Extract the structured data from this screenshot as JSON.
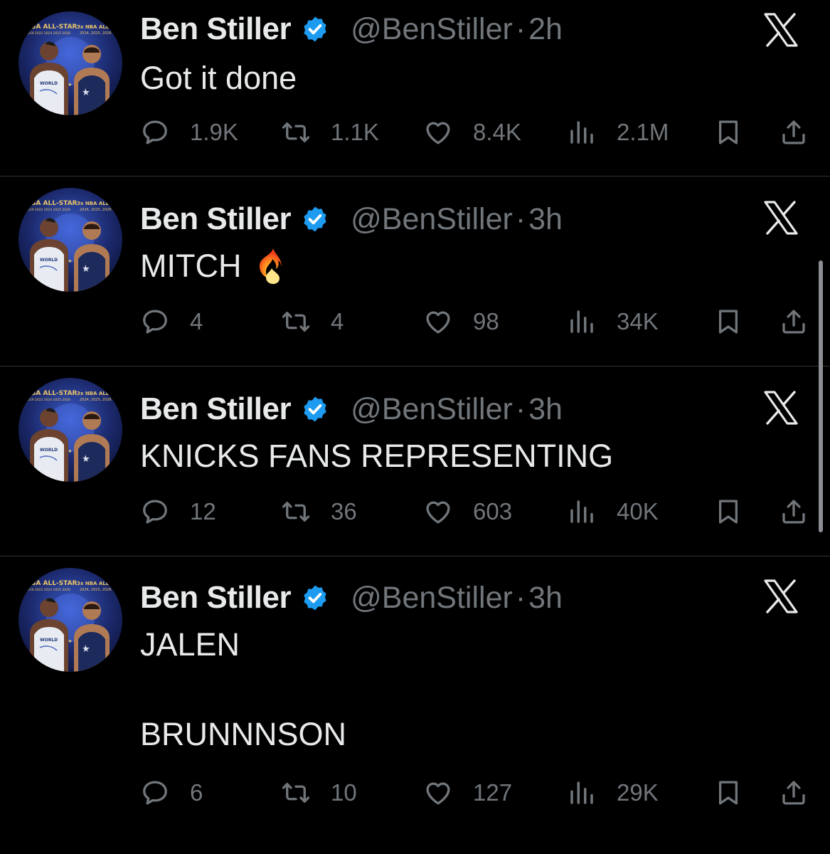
{
  "tweets": [
    {
      "name": "Ben Stiller",
      "handle": "@BenStiller",
      "separator": "·",
      "time": "2h",
      "text": "Got it done",
      "emoji": "",
      "replies": "1.9K",
      "retweets": "1.1K",
      "likes": "8.4K",
      "views": "2.1M"
    },
    {
      "name": "Ben Stiller",
      "handle": "@BenStiller",
      "separator": "·",
      "time": "3h",
      "text": "MITCH",
      "emoji": "fire-icon",
      "replies": "4",
      "retweets": "4",
      "likes": "98",
      "views": "34K"
    },
    {
      "name": "Ben Stiller",
      "handle": "@BenStiller",
      "separator": "·",
      "time": "3h",
      "text": "KNICKS FANS REPRESENTING",
      "emoji": "",
      "replies": "12",
      "retweets": "36",
      "likes": "603",
      "views": "40K"
    },
    {
      "name": "Ben Stiller",
      "handle": "@BenStiller",
      "separator": "·",
      "time": "3h",
      "text": "JALEN\n\nBRUNNNSON",
      "emoji": "",
      "replies": "6",
      "retweets": "10",
      "likes": "127",
      "views": "29K"
    }
  ],
  "avatar": {
    "banner_left": "NBA ALL-STAR",
    "banner_right": "3x NBA ALL-S",
    "years_left": "2019 2022 2024 2025 2026",
    "years_right": "2024, 2025, 2026",
    "jersey_text": "WORLD"
  },
  "colors": {
    "background": "#000000",
    "text": "#e7e9ea",
    "muted": "#71767b",
    "verified": "#1d9bf0",
    "divider": "#2f3336"
  },
  "icons": {
    "verified": "verified-badge-icon",
    "brand": "x-logo-icon",
    "reply": "reply-icon",
    "retweet": "retweet-icon",
    "like": "heart-icon",
    "views": "views-icon",
    "bookmark": "bookmark-icon",
    "share": "share-icon"
  }
}
